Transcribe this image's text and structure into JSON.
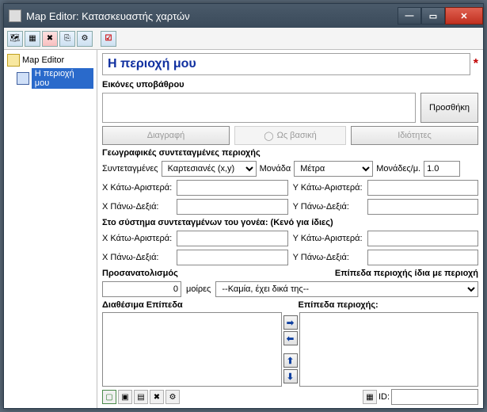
{
  "window": {
    "title": "Map Editor: Κατασκευαστής χαρτών"
  },
  "tree": {
    "root": "Map Editor",
    "selected": "Η περιοχή μου"
  },
  "header": {
    "title_value": "Η περιοχή μου"
  },
  "bg": {
    "label": "Εικόνες υποβάθρου",
    "add": "Προσθήκη",
    "delete": "Διαγραφή",
    "as_base": "Ως βασική",
    "properties": "Ιδιότητες"
  },
  "geo": {
    "section": "Γεωγραφικές συντεταγμένες περιοχής",
    "coord_label": "Συντεταγμένες",
    "coord_value": "Καρτεσιανές (x,y)",
    "unit_label": "Μονάδα",
    "unit_value": "Μέτρα",
    "per_unit_label": "Μονάδες/μ.",
    "per_unit_value": "1.0"
  },
  "fields": {
    "x_bl": "X Κάτω-Αριστερά:",
    "y_bl": "Y Κάτω-Αριστερά:",
    "x_tr": "X Πάνω-Δεξιά:",
    "y_tr": "Y Πάνω-Δεξιά:"
  },
  "parent_section": "Στο σύστημα συντεταγμένων του γονέα: (Κενό για ίδιες)",
  "orient": {
    "label": "Προσανατολισμός",
    "levels_same_label": "Επίπεδα περιοχής ίδια με περιοχή",
    "value": "0",
    "degrees": "μοίρες",
    "same_as_value": "--Καμία, έχει δικά της--"
  },
  "layers": {
    "available": "Διαθέσιμα Επίπεδα",
    "region": "Επίπεδα περιοχής:"
  },
  "bottom": {
    "id_label": "ID:"
  }
}
